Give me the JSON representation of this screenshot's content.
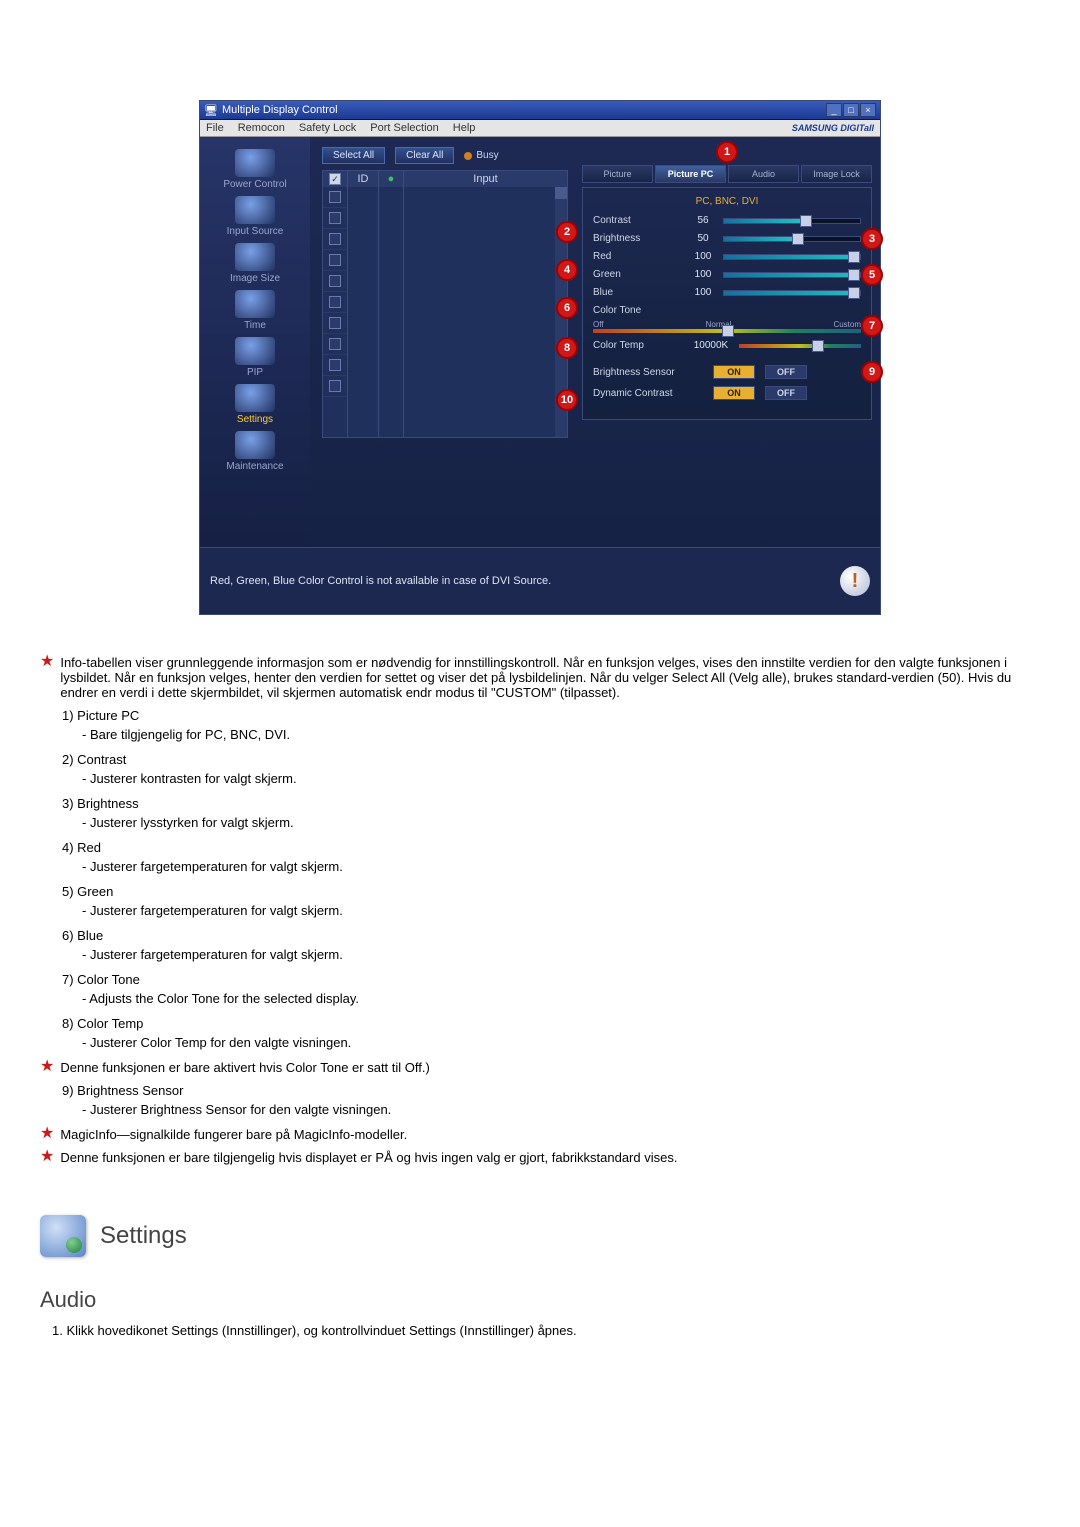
{
  "app": {
    "title": "Multiple Display Control",
    "brand": "SAMSUNG DIGITall"
  },
  "menu": {
    "file": "File",
    "remocon": "Remocon",
    "safety": "Safety Lock",
    "port": "Port Selection",
    "help": "Help"
  },
  "sidebar": {
    "items": [
      {
        "label": "Power Control"
      },
      {
        "label": "Input Source"
      },
      {
        "label": "Image Size"
      },
      {
        "label": "Time"
      },
      {
        "label": "PIP"
      },
      {
        "label": "Settings"
      },
      {
        "label": "Maintenance"
      }
    ]
  },
  "toolbar": {
    "select_all": "Select All",
    "clear_all": "Clear All",
    "busy": "Busy"
  },
  "grid": {
    "col_id": "ID",
    "col_input": "Input"
  },
  "panel": {
    "tabs": {
      "picture": "Picture",
      "picture_pc": "Picture PC",
      "audio": "Audio",
      "image_lock": "Image Lock"
    },
    "subtitle": "PC, BNC, DVI",
    "rows": {
      "contrast": {
        "label": "Contrast",
        "value": "56"
      },
      "brightness": {
        "label": "Brightness",
        "value": "50"
      },
      "red": {
        "label": "Red",
        "value": "100"
      },
      "green": {
        "label": "Green",
        "value": "100"
      },
      "blue": {
        "label": "Blue",
        "value": "100"
      },
      "color_tone": {
        "label": "Color Tone",
        "opts": {
          "off": "Off",
          "normal": "Normal",
          "custom": "Custom"
        }
      },
      "color_temp": {
        "label": "Color Temp",
        "value": "10000K"
      },
      "brightness_sensor": {
        "label": "Brightness Sensor",
        "on": "ON",
        "off": "OFF"
      },
      "dynamic_contrast": {
        "label": "Dynamic Contrast",
        "on": "ON",
        "off": "OFF"
      }
    }
  },
  "status_note": "Red, Green, Blue Color Control is not available in case of DVI Source.",
  "callouts": {
    "c1": "1",
    "c2": "2",
    "c3": "3",
    "c4": "4",
    "c5": "5",
    "c6": "6",
    "c7": "7",
    "c8": "8",
    "c9": "9",
    "c10": "10"
  },
  "text": {
    "intro": "Info-tabellen viser grunnleggende informasjon som er nødvendig for innstillingskontroll. Når en funksjon velges, vises den innstilte verdien for den valgte funksjonen i lysbildet. Når en funksjon velges, henter den verdien for settet og viser det på lysbildelinjen. Når du velger Select All (Velg alle), brukes standard-verdien (50). Hvis du endrer en verdi i dette skjermbildet, vil skjermen automatisk endr modus til \"CUSTOM\" (tilpasset).",
    "i1_t": "1)  Picture PC",
    "i1_d": "Bare tilgjengelig for PC, BNC, DVI.",
    "i2_t": "2)  Contrast",
    "i2_d": "Justerer kontrasten for valgt skjerm.",
    "i3_t": "3)  Brightness",
    "i3_d": "Justerer lysstyrken for valgt skjerm.",
    "i4_t": "4)  Red",
    "i4_d": "Justerer fargetemperaturen for valgt skjerm.",
    "i5_t": "5)  Green",
    "i5_d": "Justerer fargetemperaturen for valgt skjerm.",
    "i6_t": "6)  Blue",
    "i6_d": "Justerer fargetemperaturen for valgt skjerm.",
    "i7_t": "7)  Color Tone",
    "i7_d": "Adjusts the Color Tone for the selected display.",
    "i8_t": "8)  Color Temp",
    "i8_d": "Justerer Color Temp for den valgte visningen.",
    "note8": "Denne funksjonen er bare aktivert hvis Color Tone er satt til Off.)",
    "i9_t": "9)  Brightness Sensor",
    "i9_d": "Justerer Brightness Sensor for den valgte visningen.",
    "note_magic": "MagicInfo—signalkilde fungerer bare på MagicInfo-modeller.",
    "note_avail": "Denne funksjonen er bare tilgjengelig hvis displayet er PÅ og hvis ingen valg er gjort, fabrikkstandard vises.",
    "section_settings": "Settings",
    "audio_h": "Audio",
    "audio_1": "1.  Klikk hovedikonet Settings (Innstillinger), og kontrollvinduet Settings (Innstillinger) åpnes."
  }
}
